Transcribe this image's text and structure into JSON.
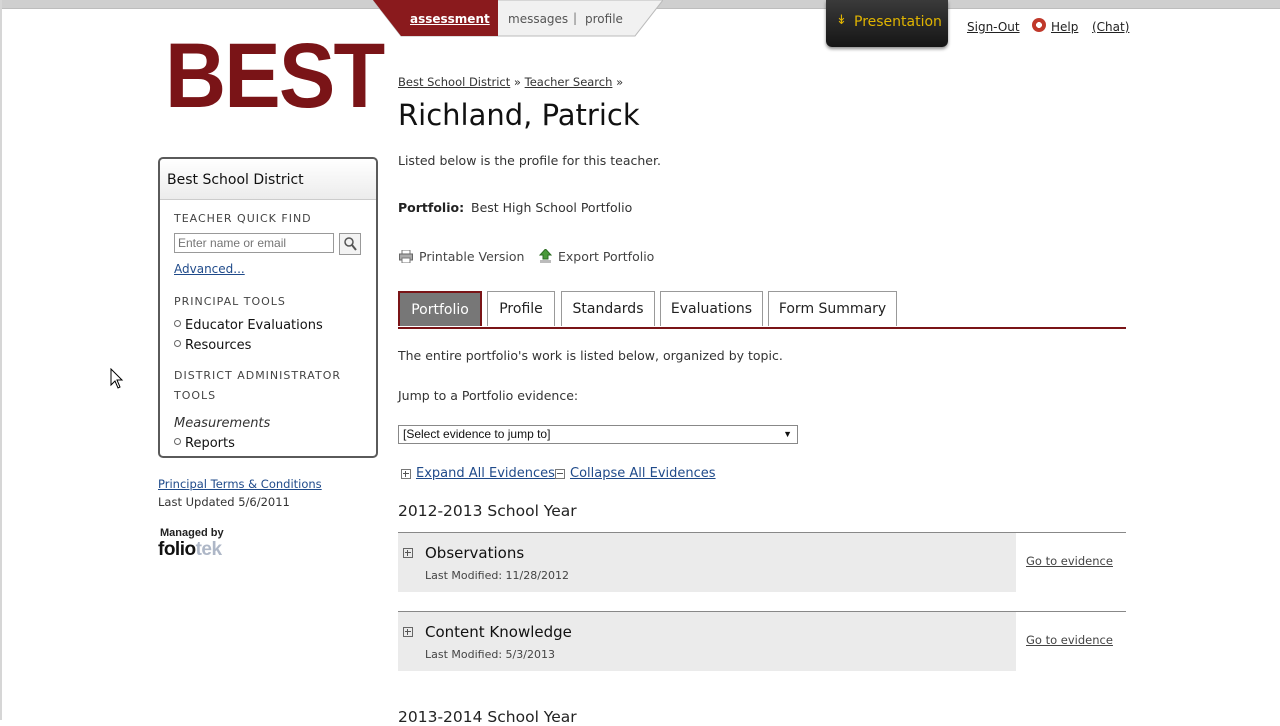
{
  "nav": {
    "assessment": "assessment",
    "messages": "messages",
    "separator": "|",
    "profile": "profile"
  },
  "presentation": "Presentation",
  "top_links": {
    "signout": "Sign-Out",
    "help": "Help",
    "chat": "(Chat)"
  },
  "logo": "BEST",
  "sidebar": {
    "title": "Best School District",
    "quick_find_heading": "TEACHER QUICK FIND",
    "search_placeholder": "Enter name or email",
    "advanced": "Advanced...",
    "principal_heading": "PRINCIPAL TOOLS",
    "principal_items": [
      "Educator Evaluations",
      "Resources"
    ],
    "district_heading_1": "DISTRICT ADMINISTRATOR",
    "district_heading_2": "TOOLS",
    "measurements": "Measurements",
    "reports": "Reports"
  },
  "footer": {
    "terms": "Principal Terms & Conditions",
    "updated": "Last Updated 5/6/2011",
    "managed_by": "Managed by",
    "brand_a": "folio",
    "brand_b": "tek"
  },
  "breadcrumb": {
    "district": "Best School District",
    "sep1": "»",
    "search": "Teacher Search",
    "sep2": "»"
  },
  "page_title": "Richland, Patrick",
  "intro": "Listed below is the profile for this teacher.",
  "portfolio": {
    "label": "Portfolio:",
    "value": "Best High School Portfolio"
  },
  "tools": {
    "printable": "Printable Version",
    "export": "Export Portfolio"
  },
  "tabs": [
    "Portfolio",
    "Profile",
    "Standards",
    "Evaluations",
    "Form Summary"
  ],
  "description": "The entire portfolio's work is listed below, organized by topic.",
  "jump_label": "Jump to a Portfolio evidence:",
  "jump_select": "[Select evidence to jump to]",
  "expand_all": "Expand All Evidences",
  "collapse_all": "Collapse All Evidences",
  "years": [
    "2012-2013 School Year",
    "2013-2014 School Year"
  ],
  "evidences": [
    {
      "title": "Observations",
      "modified": "Last Modified: 11/28/2012",
      "link": "Go to evidence"
    },
    {
      "title": "Content Knowledge",
      "modified": "Last Modified: 5/3/2013",
      "link": "Go to evidence"
    }
  ],
  "colors": {
    "brand": "#7a1417",
    "link": "#1f4a8a",
    "presentation": "#e0b400"
  }
}
